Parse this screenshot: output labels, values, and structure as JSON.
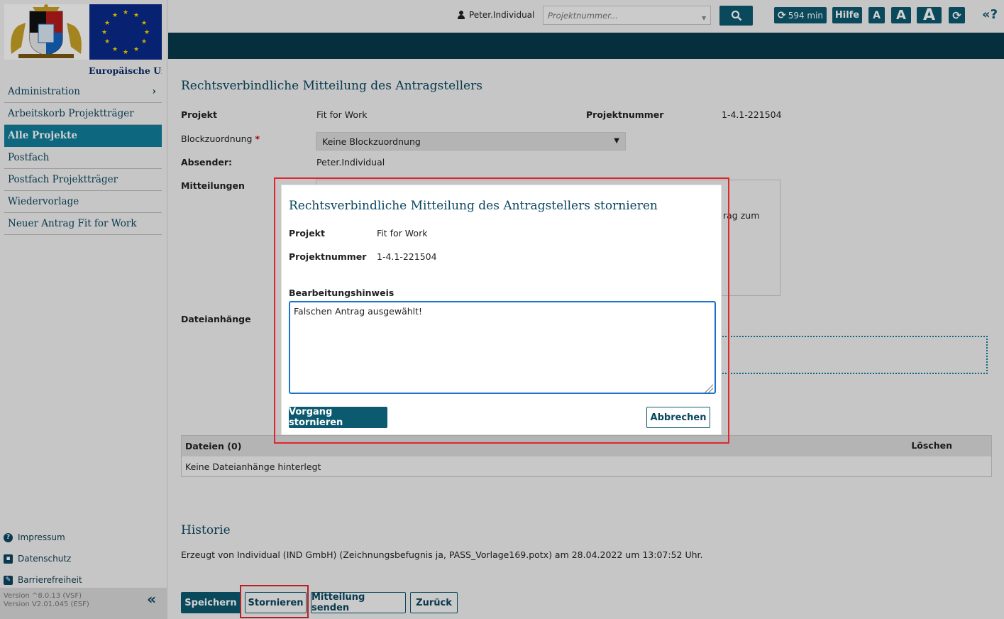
{
  "sidebar": {
    "eu_label": "Europäische Uni",
    "nav": [
      {
        "label": "Administration",
        "active": false,
        "has_chevron": true
      },
      {
        "label": "Arbeitskorb Projektträger",
        "active": false
      },
      {
        "label": "Alle Projekte",
        "active": true
      },
      {
        "label": "Postfach",
        "active": false
      },
      {
        "label": "Postfach Projektträger",
        "active": false
      },
      {
        "label": "Wiedervorlage",
        "active": false
      },
      {
        "label": "Neuer Antrag Fit for Work",
        "active": false
      }
    ],
    "links": {
      "impressum": "Impressum",
      "datenschutz": "Datenschutz",
      "barrierefreiheit": "Barrierefreiheit"
    },
    "version_line1": "Version ^8.0.13 (VSF)",
    "version_line2": "Version V2.01.045 (ESF)"
  },
  "topbar": {
    "username": "Peter.Individual",
    "project_placeholder": "Projektnummer...",
    "session_time": "594 min",
    "help_label": "Hilfe",
    "font_small": "A",
    "font_medium": "A",
    "font_large": "A",
    "help_icon_label": "«?"
  },
  "main": {
    "title": "Rechtsverbindliche Mitteilung des Antragstellers",
    "projekt_label": "Projekt",
    "projekt_value": "Fit for Work",
    "projektnummer_label": "Projektnummer",
    "projektnummer_value": "1-4.1-221504",
    "block_label": "Blockzuordnung",
    "block_required": "*",
    "block_value": "Keine Blockzuordnung",
    "absender_label": "Absender:",
    "absender_value": "Peter.Individual",
    "mitteilungen_label": "Mitteilungen",
    "mitteilungen_partial": "rag zum",
    "dateianhaenge_label": "Dateianhänge",
    "files_header": "Dateien (0)",
    "files_delete_header": "Löschen",
    "files_empty": "Keine Dateianhänge hinterlegt",
    "history_title": "Historie",
    "history_text": "Erzeugt von Individual (IND GmbH) (Zeichnungsbefugnis ja, PASS_Vorlage169.potx) am 28.04.2022 um 13:07:52 Uhr."
  },
  "buttons": {
    "save": "Speichern",
    "cancel": "Stornieren",
    "send": "Mitteilung senden",
    "back": "Zurück"
  },
  "modal": {
    "title": "Rechtsverbindliche Mitteilung des Antragstellers stornieren",
    "projekt_label": "Projekt",
    "projekt_value": "Fit for Work",
    "projektnummer_label": "Projektnummer",
    "projektnummer_value": "1-4.1-221504",
    "hint_label": "Bearbeitungshinweis",
    "hint_value": "Falschen Antrag ausgewählt!",
    "confirm_label": "Vorgang stornieren",
    "abort_label": "Abbrechen"
  },
  "colors": {
    "primary": "#0c5a70",
    "active_nav": "#0f7e9b",
    "highlight": "#e0262d",
    "strip": "#073a4b"
  }
}
